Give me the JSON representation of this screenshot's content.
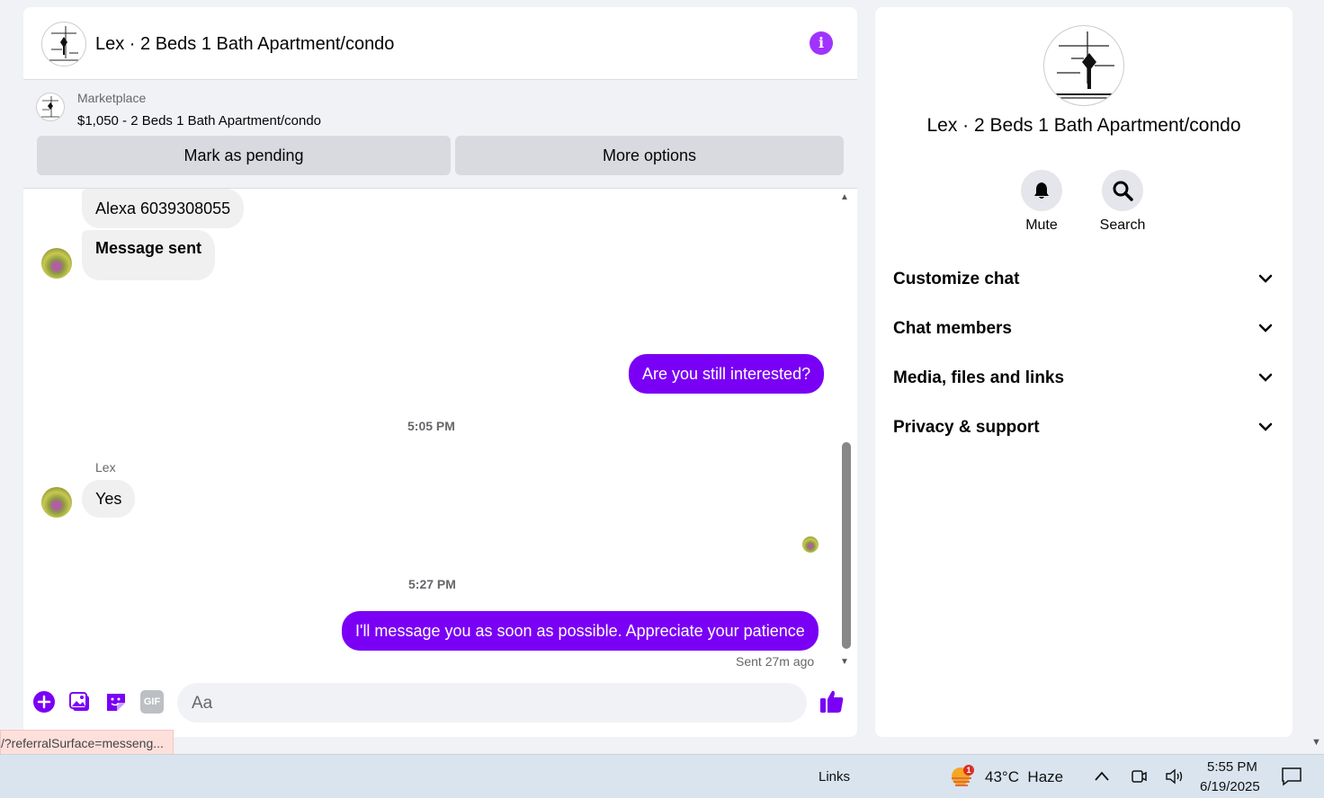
{
  "header": {
    "title": "Lex · 2 Beds 1 Bath Apartment/condo",
    "accent": "#a033ff"
  },
  "marketplace": {
    "label": "Marketplace",
    "listing": "$1,050 - 2 Beds 1 Bath Apartment/condo",
    "mark_pending_label": "Mark as pending",
    "more_options_label": "More options"
  },
  "messages": [
    {
      "from": "other",
      "text": "Alexa 6039308055"
    },
    {
      "from": "other",
      "text": "Message sent"
    },
    {
      "from": "me",
      "text": "Are you still interested?"
    },
    {
      "type": "timestamp",
      "text": "5:05 PM"
    },
    {
      "from": "other",
      "sender": "Lex",
      "text": "Yes"
    },
    {
      "type": "timestamp",
      "text": "5:27 PM"
    },
    {
      "from": "me",
      "text": "I'll message you as soon as possible. Appreciate your patience"
    }
  ],
  "sent_status": "Sent 27m ago",
  "composer": {
    "placeholder": "Aa",
    "icons": [
      "plus-icon",
      "photo-icon",
      "sticker-icon",
      "gif-icon",
      "emoji-icon",
      "thumbs-up-icon"
    ],
    "gif_label": "GIF"
  },
  "info_panel": {
    "title": "Lex · 2 Beds 1 Bath Apartment/condo",
    "mute_label": "Mute",
    "search_label": "Search",
    "sections": [
      "Customize chat",
      "Chat members",
      "Media, files and links",
      "Privacy & support"
    ]
  },
  "status_url": "/?referralSurface=messeng...",
  "taskbar": {
    "links_label": "Links",
    "weather_badge": "1",
    "weather": "43°C  Haze",
    "time": "5:55 PM",
    "date": "6/19/2025"
  },
  "colors": {
    "outgoing_bubble": "#7a00f5",
    "incoming_bubble": "#f0f0f0",
    "icon_purple": "#7a00f5"
  }
}
